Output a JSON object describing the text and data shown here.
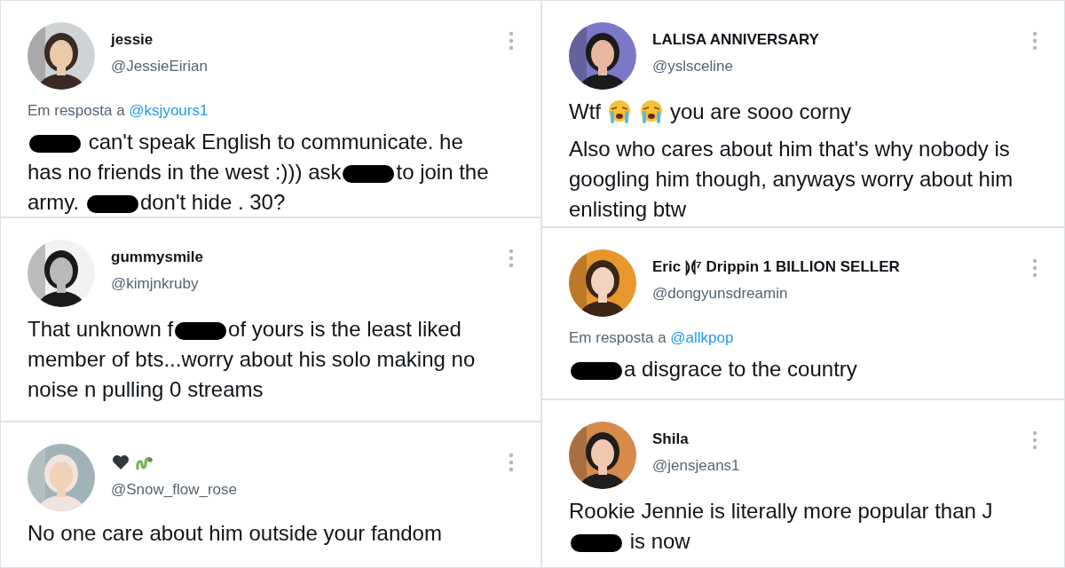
{
  "columns": [
    {
      "tweets": [
        {
          "name": "jessie",
          "handle": "@JessieEirian",
          "reply": {
            "label": "Em resposta a",
            "handle": "@ksjyours1"
          },
          "paragraphs": [
            [
              {
                "kind": "redaction"
              },
              {
                "kind": "text",
                "text": " can't speak English to communicate.  he has no friends in the west :)))   ask"
              },
              {
                "kind": "redaction"
              },
              {
                "kind": "text",
                "text": "to join the army. "
              },
              {
                "kind": "redaction"
              },
              {
                "kind": "text",
                "text": "don't hide  . 30?"
              }
            ]
          ]
        },
        {
          "name": "gummysmile",
          "handle": "@kimjnkruby",
          "paragraphs": [
            [
              {
                "kind": "text",
                "text": "That unknown f"
              },
              {
                "kind": "redaction"
              },
              {
                "kind": "text",
                "text": "of yours is the least liked member of bts...worry about his solo making no noise n pulling 0 streams"
              }
            ]
          ]
        },
        {
          "kind": "emoji-name",
          "handle": "@Snow_flow_rose",
          "paragraphs": [
            [
              {
                "kind": "text",
                "text": "No one care about him outside your fandom"
              }
            ]
          ]
        }
      ]
    },
    {
      "tweets": [
        {
          "name": "LALISA ANNIVERSARY",
          "handle": "@yslsceline",
          "paragraphs": [
            [
              {
                "kind": "text",
                "text": "Wtf"
              },
              {
                "kind": "emoji"
              },
              {
                "kind": "emoji"
              },
              {
                "kind": "text",
                "text": "you are sooo corny"
              }
            ],
            [
              {
                "kind": "text",
                "text": "Also who cares about him that's why nobody is googling him though, anyways worry about him enlisting btw"
              }
            ]
          ]
        },
        {
          "name": "Eric ⟭⟬⁷ Drippin 1 BILLION SELLER",
          "handle": "@dongyunsdreamin",
          "reply": {
            "label": "Em resposta a",
            "handle": "@allkpop"
          },
          "paragraphs": [
            [
              {
                "kind": "redaction"
              },
              {
                "kind": "text",
                "text": "a disgrace to the country"
              }
            ]
          ]
        },
        {
          "name": "Shila",
          "handle": "@jensjeans1",
          "paragraphs": [
            [
              {
                "kind": "text",
                "text": "Rookie Jennie is literally more popular than J"
              },
              {
                "kind": "redaction"
              },
              {
                "kind": "text",
                "text": " is now"
              }
            ]
          ]
        }
      ]
    }
  ]
}
